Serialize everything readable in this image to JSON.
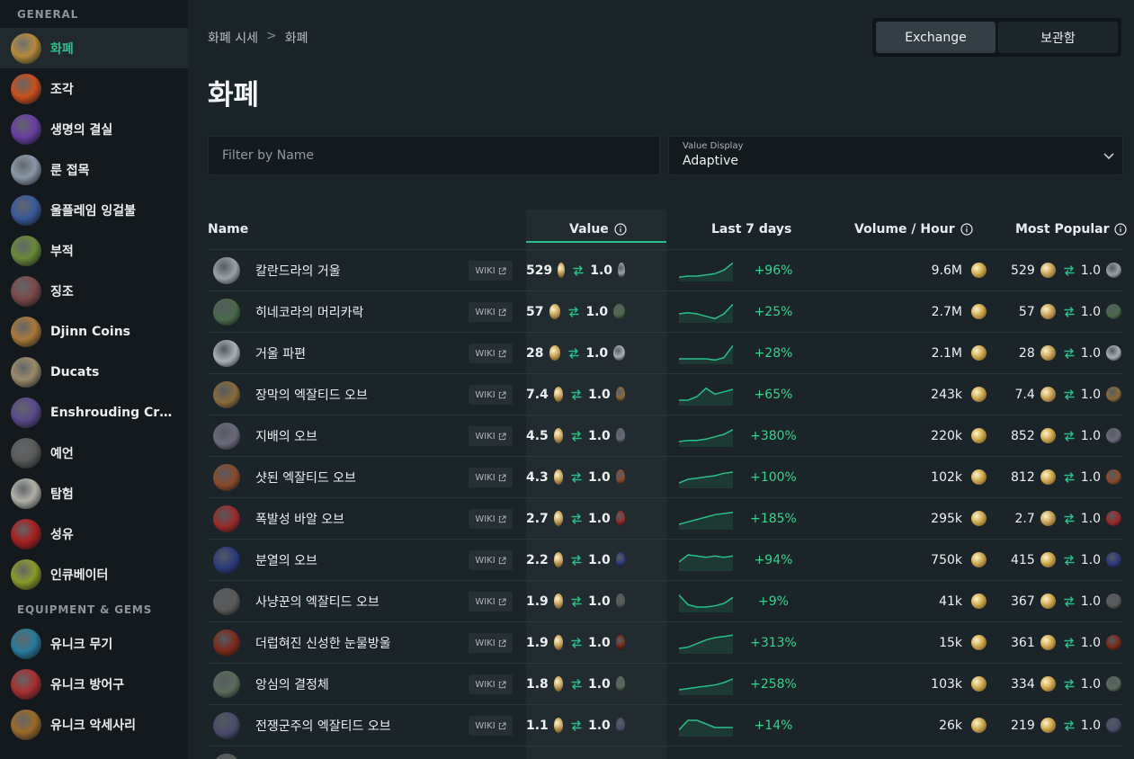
{
  "sidebar": {
    "sections": [
      {
        "title": "GENERAL",
        "items": [
          {
            "label": "화폐",
            "icon": "currency-icon",
            "color": "#b48a3c",
            "active": true
          },
          {
            "label": "조각",
            "icon": "fragment-icon",
            "color": "#c8501e",
            "active": false
          },
          {
            "label": "생명의 결실",
            "icon": "life-fruit-icon",
            "color": "#6a3fa0",
            "active": false
          },
          {
            "label": "룬 접목",
            "icon": "rune-graft-icon",
            "color": "#8a98a8",
            "active": false
          },
          {
            "label": "울플레임 잉걸불",
            "icon": "ember-icon",
            "color": "#3a5a9a",
            "active": false
          },
          {
            "label": "부적",
            "icon": "tattoo-icon",
            "color": "#6a8a3a",
            "active": false
          },
          {
            "label": "징조",
            "icon": "omen-icon",
            "color": "#7a4a4a",
            "active": false
          },
          {
            "label": "Djinn Coins",
            "icon": "djinn-coin-icon",
            "color": "#a8783a",
            "active": false
          },
          {
            "label": "Ducats",
            "icon": "ducat-icon",
            "color": "#9a8a6a",
            "active": false
          },
          {
            "label": "Enshrouding Crys...",
            "icon": "crystal-icon",
            "color": "#5a4a8a",
            "active": false
          },
          {
            "label": "예언",
            "icon": "prophecy-icon",
            "color": "#5a5a5a",
            "active": false
          },
          {
            "label": "탐험",
            "icon": "expedition-icon",
            "color": "#b0b0a8",
            "active": false
          },
          {
            "label": "성유",
            "icon": "oil-icon",
            "color": "#a82020",
            "active": false
          },
          {
            "label": "인큐베이터",
            "icon": "incubator-icon",
            "color": "#8a9a2a",
            "active": false
          }
        ]
      },
      {
        "title": "EQUIPMENT & GEMS",
        "items": [
          {
            "label": "유니크 무기",
            "icon": "unique-weapon-icon",
            "color": "#2a7a9a",
            "active": false
          },
          {
            "label": "유니크 방어구",
            "icon": "unique-armour-icon",
            "color": "#a83030",
            "active": false
          },
          {
            "label": "유니크 악세사리",
            "icon": "unique-accessory-icon",
            "color": "#9a6a2a",
            "active": false
          }
        ]
      }
    ]
  },
  "breadcrumb": {
    "root": "화폐 시세",
    "separator": ">",
    "current": "화폐"
  },
  "page_title": "화폐",
  "toggle": {
    "exchange_label": "Exchange",
    "stash_label": "보관함",
    "active": "exchange"
  },
  "filter": {
    "placeholder": "Filter by Name",
    "value": ""
  },
  "value_display": {
    "label": "Value Display",
    "value": "Adaptive"
  },
  "table": {
    "headers": {
      "name": "Name",
      "value": "Value",
      "last7": "Last 7 days",
      "volume": "Volume / Hour",
      "popular": "Most Popular"
    },
    "wiki_label": "WIKI",
    "rows": [
      {
        "name": "칼란드라의 거울",
        "icon_color": "#9aa0a8",
        "value": "529",
        "ratio": "1.0",
        "trend": [
          2,
          3,
          3,
          4,
          5,
          8,
          14
        ],
        "change": "+96%",
        "volume": "9.6M",
        "pop_value": "529",
        "pop_coin": "chaos",
        "pop_ratio": "1.0"
      },
      {
        "name": "히네코라의 머리카락",
        "icon_color": "#4a6a4a",
        "value": "57",
        "ratio": "1.0",
        "trend": [
          6,
          7,
          6,
          4,
          2,
          6,
          14
        ],
        "change": "+25%",
        "volume": "2.7M",
        "pop_value": "57",
        "pop_coin": "chaos",
        "pop_ratio": "1.0"
      },
      {
        "name": "거울 파편",
        "icon_color": "#a8b0b8",
        "value": "28",
        "ratio": "1.0",
        "trend": [
          3,
          3,
          3,
          3,
          2,
          4,
          14
        ],
        "change": "+28%",
        "volume": "2.1M",
        "pop_value": "28",
        "pop_coin": "chaos",
        "pop_ratio": "1.0"
      },
      {
        "name": "장막의 엑잘티드 오브",
        "icon_color": "#8a6a3a",
        "value": "7.4",
        "ratio": "1.0",
        "trend": [
          3,
          3,
          6,
          13,
          8,
          10,
          12
        ],
        "change": "+65%",
        "volume": "243k",
        "pop_value": "7.4",
        "pop_coin": "chaos",
        "pop_ratio": "1.0"
      },
      {
        "name": "지배의 오브",
        "icon_color": "#6a6a7a",
        "value": "4.5",
        "ratio": "1.0",
        "trend": [
          3,
          4,
          4,
          5,
          7,
          9,
          13
        ],
        "change": "+380%",
        "volume": "220k",
        "pop_value": "852",
        "pop_coin": "divine",
        "pop_ratio": "1.0"
      },
      {
        "name": "샷된 엑잘티드 오브",
        "icon_color": "#8a4a2a",
        "value": "4.3",
        "ratio": "1.0",
        "trend": [
          3,
          6,
          7,
          8,
          9,
          11,
          12
        ],
        "change": "+100%",
        "volume": "102k",
        "pop_value": "812",
        "pop_coin": "divine",
        "pop_ratio": "1.0"
      },
      {
        "name": "폭발성 바알 오브",
        "icon_color": "#9a2a2a",
        "value": "2.7",
        "ratio": "1.0",
        "trend": [
          3,
          5,
          7,
          9,
          11,
          12,
          13
        ],
        "change": "+185%",
        "volume": "295k",
        "pop_value": "2.7",
        "pop_coin": "chaos",
        "pop_ratio": "1.0"
      },
      {
        "name": "분열의 오브",
        "icon_color": "#2a3a7a",
        "value": "2.2",
        "ratio": "1.0",
        "trend": [
          6,
          12,
          11,
          10,
          11,
          10,
          11
        ],
        "change": "+94%",
        "volume": "750k",
        "pop_value": "415",
        "pop_coin": "divine",
        "pop_ratio": "1.0"
      },
      {
        "name": "사냥꾼의 엑잘티드 오브",
        "icon_color": "#5a5a5a",
        "value": "1.9",
        "ratio": "1.0",
        "trend": [
          13,
          5,
          3,
          3,
          4,
          6,
          11
        ],
        "change": "+9%",
        "volume": "41k",
        "pop_value": "367",
        "pop_coin": "divine",
        "pop_ratio": "1.0"
      },
      {
        "name": "더럽혀진 신성한 눈물방울",
        "icon_color": "#7a2a1a",
        "value": "1.9",
        "ratio": "1.0",
        "trend": [
          3,
          4,
          7,
          10,
          12,
          13,
          14
        ],
        "change": "+313%",
        "volume": "15k",
        "pop_value": "361",
        "pop_coin": "divine",
        "pop_ratio": "1.0"
      },
      {
        "name": "앙심의 결정체",
        "icon_color": "#5a6a5a",
        "value": "1.8",
        "ratio": "1.0",
        "trend": [
          3,
          4,
          5,
          6,
          7,
          9,
          12
        ],
        "change": "+258%",
        "volume": "103k",
        "pop_value": "334",
        "pop_coin": "divine",
        "pop_ratio": "1.0"
      },
      {
        "name": "전쟁군주의 엑잘티드 오브",
        "icon_color": "#4a4a6a",
        "value": "1.1",
        "ratio": "1.0",
        "trend": [
          4,
          12,
          12,
          9,
          6,
          6,
          6
        ],
        "change": "+14%",
        "volume": "26k",
        "pop_value": "219",
        "pop_coin": "divine",
        "pop_ratio": "1.0"
      },
      {
        "name": "",
        "icon_color": "#5a5a5a",
        "value": "",
        "ratio": "",
        "trend": [],
        "change": "",
        "volume": "",
        "pop_value": "",
        "pop_coin": "chaos",
        "pop_ratio": ""
      }
    ]
  },
  "colors": {
    "accent": "#27c08a",
    "positive": "#35d48d",
    "chaos_coin": "#c8a35a",
    "divine_coin": "#cfa84e",
    "swap": "#27c08a"
  }
}
